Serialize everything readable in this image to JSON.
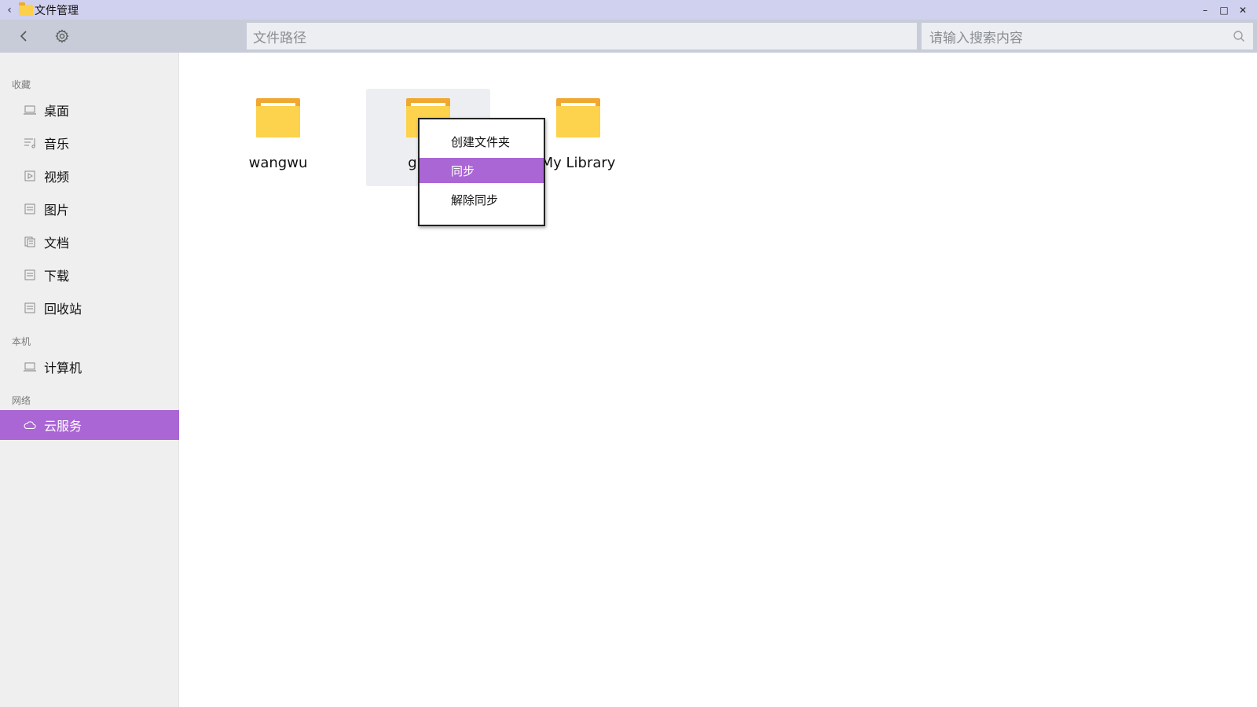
{
  "window": {
    "title": "文件管理",
    "back_glyph": "‹",
    "minimize_glyph": "–",
    "maximize_glyph": "□",
    "close_glyph": "✕"
  },
  "toolbar": {
    "path_placeholder": "文件路径",
    "search_placeholder": "请输入搜索内容"
  },
  "sidebar": {
    "sections": {
      "favorites": "收藏",
      "local": "本机",
      "network": "网络"
    },
    "items": [
      {
        "label": "桌面",
        "icon": "desktop-icon"
      },
      {
        "label": "音乐",
        "icon": "music-icon"
      },
      {
        "label": "视频",
        "icon": "video-icon"
      },
      {
        "label": "图片",
        "icon": "image-icon"
      },
      {
        "label": "文档",
        "icon": "document-icon"
      },
      {
        "label": "下载",
        "icon": "download-icon"
      },
      {
        "label": "回收站",
        "icon": "trash-icon"
      },
      {
        "label": "计算机",
        "icon": "computer-icon"
      },
      {
        "label": "云服务",
        "icon": "cloud-icon",
        "active": true
      }
    ]
  },
  "files": [
    {
      "name": "wangwu"
    },
    {
      "name": "g",
      "selected": true
    },
    {
      "name": "My Library"
    }
  ],
  "context_menu": {
    "items": [
      {
        "label": "创建文件夹"
      },
      {
        "label": "同步",
        "active": true
      },
      {
        "label": "解除同步"
      }
    ]
  },
  "colors": {
    "accent": "#aa66d4",
    "titlebar": "#d0d0ef",
    "toolbar": "#c7ccd8",
    "folder_yellow": "#fdd24c",
    "folder_orange": "#f0a830"
  }
}
